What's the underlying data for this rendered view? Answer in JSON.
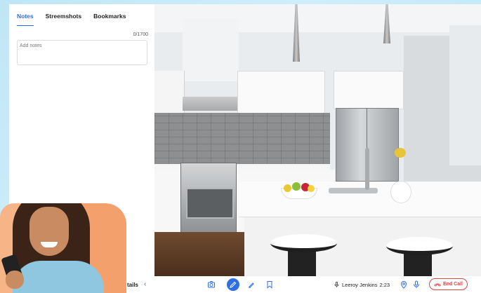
{
  "notes_panel": {
    "tabs": [
      {
        "label": "Notes",
        "active": true
      },
      {
        "label": "Streemshots",
        "active": false
      },
      {
        "label": "Bookmarks",
        "active": false
      }
    ],
    "counter": "0/1700",
    "notes_placeholder": "Add notes",
    "notes_value": "",
    "details_label": "tails"
  },
  "toolbar": {
    "caller_name": "Leeroy Jenkins",
    "call_duration": "2:23",
    "end_call_label": "End Call",
    "icons": [
      "camera-icon",
      "pen-icon",
      "draw-icon",
      "bookmark-icon",
      "location-icon",
      "microphone-icon",
      "phone-hangup-icon"
    ]
  },
  "colors": {
    "accent": "#2f6fe4",
    "end_call": "#e04545",
    "promo_background": "#f3a06c"
  }
}
